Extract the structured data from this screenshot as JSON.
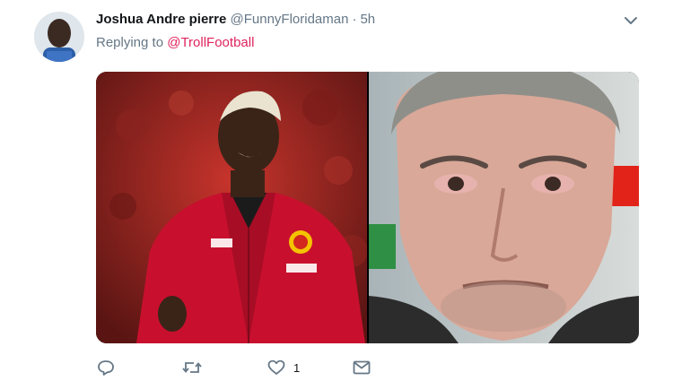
{
  "tweet": {
    "author_name": "Joshua Andre pierre",
    "author_handle": "@FunnyFloridaman",
    "separator": "·",
    "timestamp": "5h",
    "reply_prefix": "Replying to",
    "reply_mention": "@TrollFootball",
    "media": [
      {
        "kind": "photo",
        "subject": "player-in-red-jacket"
      },
      {
        "kind": "photo",
        "subject": "man-with-teary-eyes"
      }
    ],
    "actions": {
      "reply": {
        "icon": "reply-icon"
      },
      "retweet": {
        "icon": "retweet-icon"
      },
      "like": {
        "icon": "heart-icon",
        "count": "1"
      },
      "message": {
        "icon": "envelope-icon"
      }
    }
  },
  "colors": {
    "name": "#14171a",
    "muted": "#657786",
    "mention": "#e0245e",
    "jacket_red": "#c8102e"
  }
}
